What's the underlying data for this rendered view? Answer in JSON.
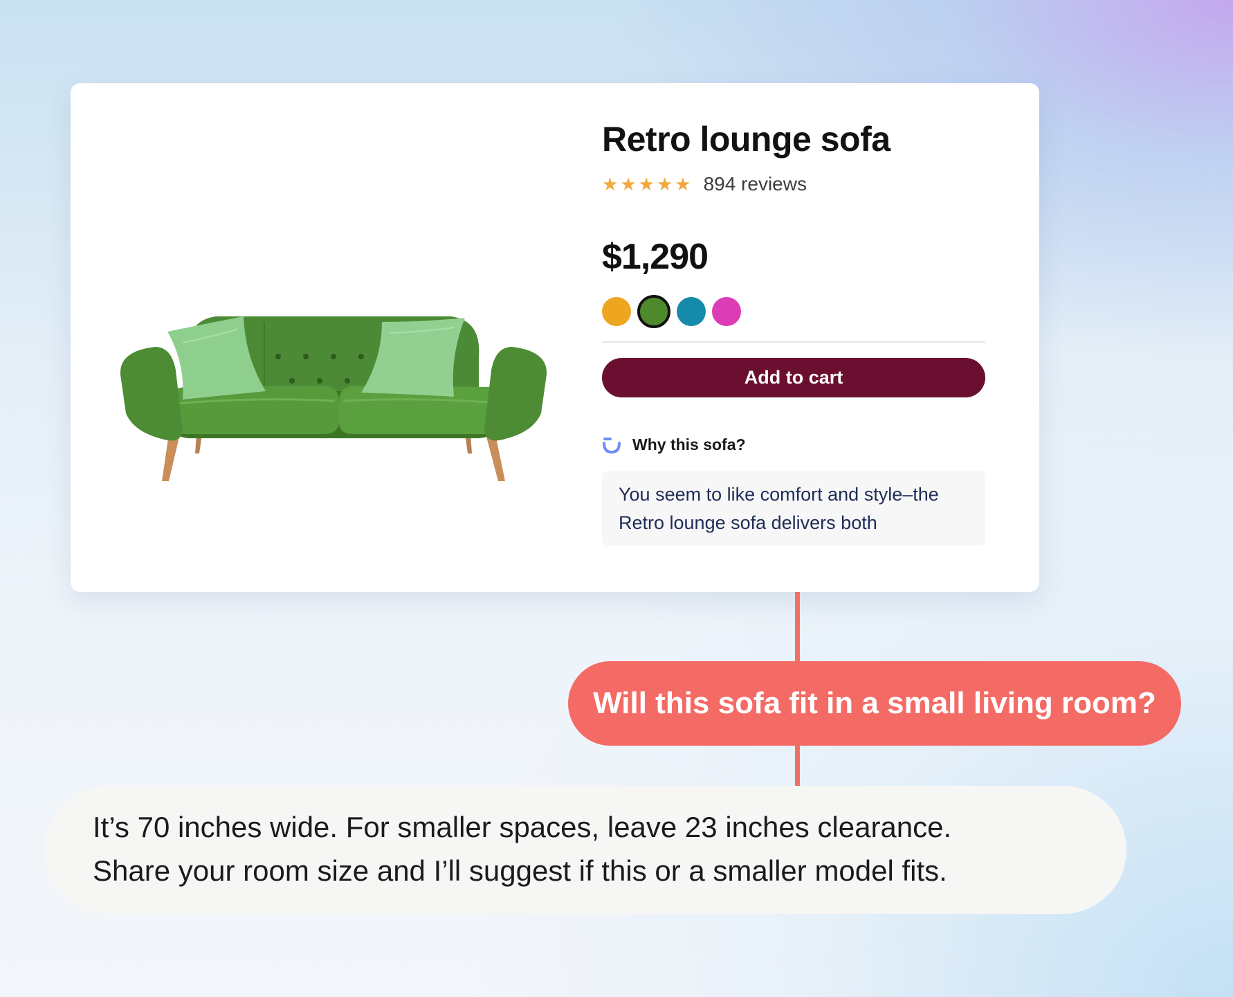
{
  "product": {
    "title": "Retro lounge sofa",
    "image_alt": "green retro lounge sofa",
    "rating": 5,
    "rating_max": 5,
    "review_count": "894 reviews",
    "price": "$1,290",
    "colors": [
      {
        "name": "orange",
        "hex": "#eea51f",
        "selected": false
      },
      {
        "name": "green",
        "hex": "#4e8a2b",
        "selected": true
      },
      {
        "name": "teal",
        "hex": "#168aa9",
        "selected": false
      },
      {
        "name": "magenta",
        "hex": "#dc3cb4",
        "selected": false
      }
    ],
    "add_to_cart_label": "Add to cart"
  },
  "why": {
    "label": "Why this sofa?",
    "icon": "ai-spark-icon",
    "text": "You seem to like comfort and style–the Retro lounge sofa delivers both"
  },
  "chat": {
    "question": "Will this sofa fit in a small living room?",
    "answer_lines": [
      "It’s 70 inches wide. For smaller spaces, leave 23 inches clearance.",
      "Share your room size and I’ll suggest if this or a smaller model fits."
    ]
  },
  "colors": {
    "cart_button": "#6b0f30",
    "question_bubble": "#f46b66",
    "connector": "#f07068",
    "star": "#f1a93a"
  }
}
